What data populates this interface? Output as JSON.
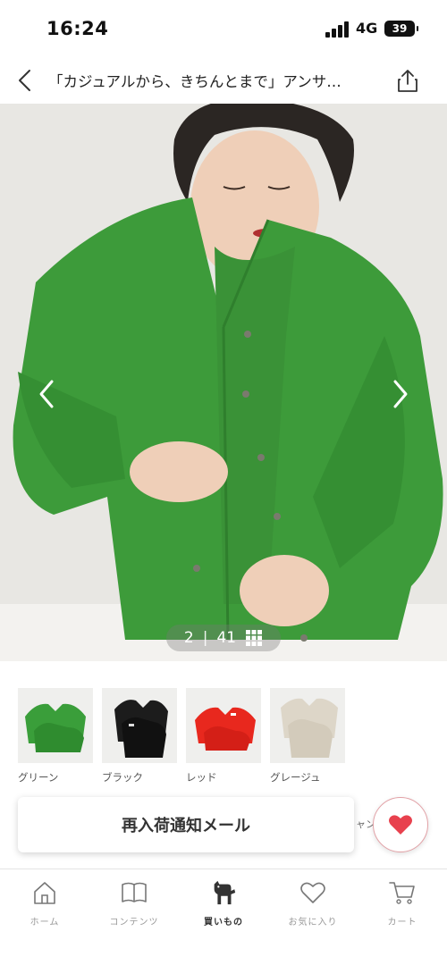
{
  "status": {
    "time": "16:24",
    "network": "4G",
    "battery": "39"
  },
  "nav": {
    "title": "「カジュアルから、きちんとまで」アンサ…"
  },
  "hero": {
    "current_index": "2",
    "separator": "|",
    "total": "41"
  },
  "colors": {
    "options": [
      {
        "label": "グリーン",
        "hex": "#3a9e3a"
      },
      {
        "label": "ブラック",
        "hex": "#1c1c1c"
      },
      {
        "label": "レッド",
        "hex": "#e8281e"
      },
      {
        "label": "グレージュ",
        "hex": "#ddd6c8"
      }
    ]
  },
  "actions": {
    "notify_label": "再入荷通知メール",
    "behind_text": "ャン",
    "favorite_color": "#e8414e"
  },
  "tabs": [
    {
      "label": "ホーム",
      "icon": "home-icon"
    },
    {
      "label": "コンテンツ",
      "icon": "book-icon"
    },
    {
      "label": "買いもの",
      "icon": "horse-icon",
      "active": true
    },
    {
      "label": "お気に入り",
      "icon": "heart-outline-icon"
    },
    {
      "label": "カート",
      "icon": "cart-icon"
    }
  ]
}
